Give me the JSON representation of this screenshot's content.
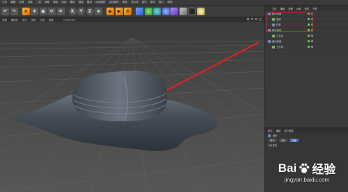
{
  "menubar": {
    "items": [
      "文件",
      "编辑",
      "创建",
      "选择",
      "工具",
      "网格",
      "捕捉",
      "动画",
      "模拟",
      "渲染",
      "雕刻",
      "运动跟踪",
      "运动图形",
      "角色",
      "流水线",
      "插件",
      "脚本",
      "窗口",
      "帮助"
    ]
  },
  "toolbar": {
    "axis_x": "X",
    "axis_y": "Y",
    "axis_z": "Z"
  },
  "viewport": {
    "menus": [
      "查看",
      "摄像机",
      "显示",
      "选项",
      "过滤",
      "面板"
    ],
    "label": "ProRender"
  },
  "object_manager": {
    "tabs": [
      "文件",
      "编辑",
      "查看",
      "对象",
      "标签",
      "书签"
    ],
    "rows": [
      {
        "label": "细分曲面",
        "child": false
      },
      {
        "label": "旋转",
        "child": true
      },
      {
        "label": "样条",
        "child": true
      },
      {
        "label": "细分曲面",
        "child": false
      },
      {
        "label": "立方体",
        "child": true
      },
      {
        "label": "细分曲面",
        "child": false
      },
      {
        "label": "立方体",
        "child": true
      }
    ]
  },
  "attribute_manager": {
    "tabs": [
      "模式",
      "编辑",
      "用户数据"
    ],
    "object_label": "细分",
    "chips": [
      "基本",
      "坐标",
      "对象"
    ],
    "section_title": "对象属性"
  },
  "watermark": {
    "brand_left": "Bai",
    "brand_right": "经验",
    "url": "jingyan.baidu.com"
  },
  "colors": {
    "annotation": "#e0201f",
    "hat": "#3c434c"
  }
}
